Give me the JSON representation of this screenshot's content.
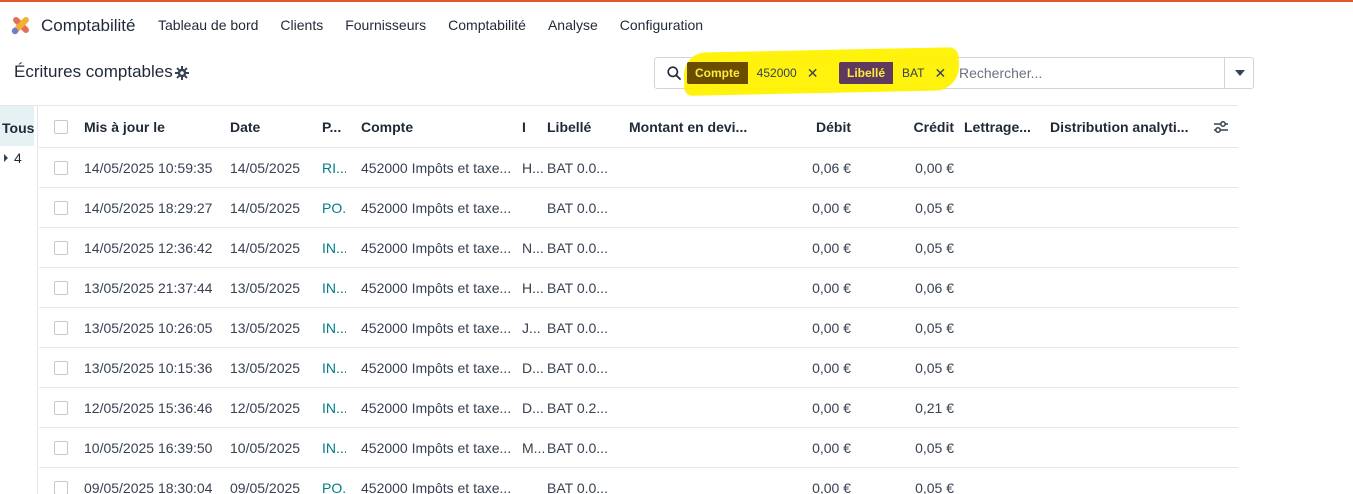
{
  "app": {
    "name": "Comptabilité",
    "logo_icon": "odoo-accounting-logo-icon",
    "menu": [
      "Tableau de bord",
      "Clients",
      "Fournisseurs",
      "Comptabilité",
      "Analyse",
      "Configuration"
    ]
  },
  "control": {
    "title": "Écritures comptables",
    "gear_icon": "gear-icon"
  },
  "search": {
    "facets": [
      {
        "label": "Compte",
        "value": "452000"
      },
      {
        "label": "Libellé",
        "value": "BAT"
      }
    ],
    "close_glyph": "✕",
    "placeholder": "Rechercher...",
    "colors": {
      "highlight": "#fff200",
      "facet1": "#6b4d00",
      "facet2": "#5e3b5e"
    }
  },
  "sidebar": {
    "all_label": "Tous",
    "count": "4"
  },
  "table": {
    "headers": {
      "updated": "Mis à jour le",
      "date": "Date",
      "partner": "P...",
      "account": "Compte",
      "i": "I",
      "label": "Libellé",
      "currency_amount": "Montant en devi...",
      "debit": "Débit",
      "credit": "Crédit",
      "matching": "Lettrage...",
      "analytic": "Distribution analyti..."
    },
    "rows": [
      {
        "updated": "14/05/2025 10:59:35",
        "date": "14/05/2025",
        "journal": "RI...",
        "account": "452000 Impôts et taxe...",
        "i": "H...",
        "label": "BAT 0.0...",
        "debit": "0,06 €",
        "credit": "0,00 €"
      },
      {
        "updated": "14/05/2025 18:29:27",
        "date": "14/05/2025",
        "journal": "PO...",
        "account": "452000 Impôts et taxe...",
        "i": "",
        "label": "BAT 0.0...",
        "debit": "0,00 €",
        "credit": "0,05 €"
      },
      {
        "updated": "14/05/2025 12:36:42",
        "date": "14/05/2025",
        "journal": "IN...",
        "account": "452000 Impôts et taxe...",
        "i": "N...",
        "label": "BAT 0.0...",
        "debit": "0,00 €",
        "credit": "0,05 €"
      },
      {
        "updated": "13/05/2025 21:37:44",
        "date": "13/05/2025",
        "journal": "IN...",
        "account": "452000 Impôts et taxe...",
        "i": "H...",
        "label": "BAT 0.0...",
        "debit": "0,00 €",
        "credit": "0,06 €"
      },
      {
        "updated": "13/05/2025 10:26:05",
        "date": "13/05/2025",
        "journal": "IN...",
        "account": "452000 Impôts et taxe...",
        "i": "J...",
        "label": "BAT 0.0...",
        "debit": "0,00 €",
        "credit": "0,05 €"
      },
      {
        "updated": "13/05/2025 10:15:36",
        "date": "13/05/2025",
        "journal": "IN...",
        "account": "452000 Impôts et taxe...",
        "i": "D...",
        "label": "BAT 0.0...",
        "debit": "0,00 €",
        "credit": "0,05 €"
      },
      {
        "updated": "12/05/2025 15:36:46",
        "date": "12/05/2025",
        "journal": "IN...",
        "account": "452000 Impôts et taxe...",
        "i": "D...",
        "label": "BAT 0.2...",
        "debit": "0,00 €",
        "credit": "0,21 €"
      },
      {
        "updated": "10/05/2025 16:39:50",
        "date": "10/05/2025",
        "journal": "IN...",
        "account": "452000 Impôts et taxe...",
        "i": "M...",
        "label": "BAT 0.0...",
        "debit": "0,00 €",
        "credit": "0,05 €"
      },
      {
        "updated": "09/05/2025 18:30:04",
        "date": "09/05/2025",
        "journal": "PO...",
        "account": "452000 Impôts et taxe...",
        "i": "",
        "label": "BAT 0.0...",
        "debit": "0,00 €",
        "credit": "0,05 €"
      }
    ],
    "optional_columns_icon": "sliders-icon"
  }
}
